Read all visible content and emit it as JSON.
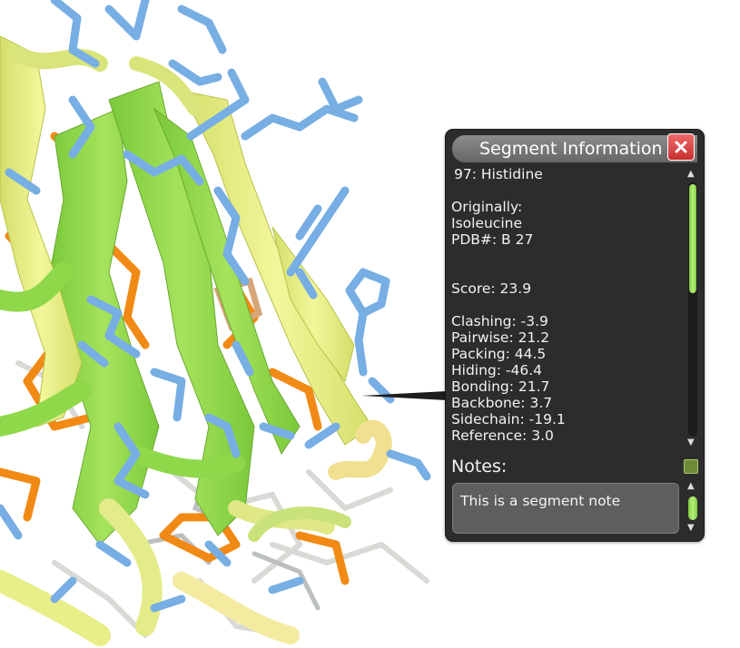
{
  "panel": {
    "title": "Segment Information",
    "close_icon": "close-icon"
  },
  "segment": {
    "heading": "97: Histidine",
    "originally_label": "Originally:",
    "original_residue": "Isoleucine",
    "pdb": "PDB#: B 27",
    "score": "Score: 23.9",
    "terms": [
      "Clashing: -3.9",
      "Pairwise: 21.2",
      "Packing: 44.5",
      "Hiding: -46.4",
      "Bonding: 21.7",
      "Backbone: 3.7",
      "Sidechain: -19.1",
      "Reference: 3.0"
    ]
  },
  "notes": {
    "label": "Notes:",
    "value": "This is a segment note",
    "icon": "notes-icon"
  },
  "colors": {
    "strand_green": "#8ed84a",
    "strand_yellow": "#eef28a",
    "sidechain_blue": "#77aee3",
    "sidechain_orange": "#f18a15",
    "close_red": "#d9413f",
    "scroll_thumb_green": "#9fe05a"
  }
}
